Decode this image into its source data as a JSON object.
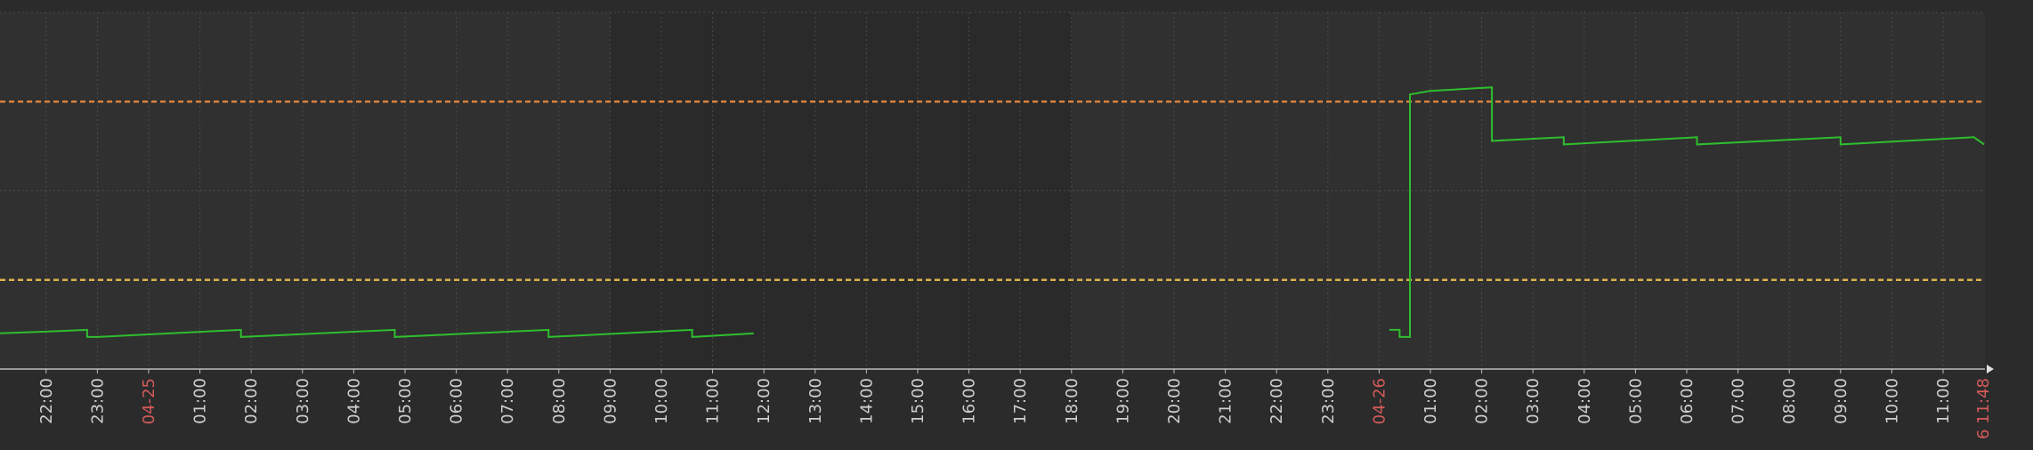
{
  "chart_data": {
    "type": "line",
    "title": "",
    "xlabel": "",
    "ylabel": "",
    "grid": true,
    "x_start": "2024-04-24 21:00",
    "x_end": "2024-04-26 11:48",
    "x_ticks": [
      {
        "label": "22:00",
        "time": "04-24 22:00",
        "red": false
      },
      {
        "label": "23:00",
        "time": "04-24 23:00",
        "red": false
      },
      {
        "label": "04-25",
        "time": "04-25 00:00",
        "red": true
      },
      {
        "label": "01:00",
        "time": "04-25 01:00",
        "red": false
      },
      {
        "label": "02:00",
        "time": "04-25 02:00",
        "red": false
      },
      {
        "label": "03:00",
        "time": "04-25 03:00",
        "red": false
      },
      {
        "label": "04:00",
        "time": "04-25 04:00",
        "red": false
      },
      {
        "label": "05:00",
        "time": "04-25 05:00",
        "red": false
      },
      {
        "label": "06:00",
        "time": "04-25 06:00",
        "red": false
      },
      {
        "label": "07:00",
        "time": "04-25 07:00",
        "red": false
      },
      {
        "label": "08:00",
        "time": "04-25 08:00",
        "red": false
      },
      {
        "label": "09:00",
        "time": "04-25 09:00",
        "red": false
      },
      {
        "label": "10:00",
        "time": "04-25 10:00",
        "red": false
      },
      {
        "label": "11:00",
        "time": "04-25 11:00",
        "red": false
      },
      {
        "label": "12:00",
        "time": "04-25 12:00",
        "red": false
      },
      {
        "label": "13:00",
        "time": "04-25 13:00",
        "red": false
      },
      {
        "label": "14:00",
        "time": "04-25 14:00",
        "red": false
      },
      {
        "label": "15:00",
        "time": "04-25 15:00",
        "red": false
      },
      {
        "label": "16:00",
        "time": "04-25 16:00",
        "red": false
      },
      {
        "label": "17:00",
        "time": "04-25 17:00",
        "red": false
      },
      {
        "label": "18:00",
        "time": "04-25 18:00",
        "red": false
      },
      {
        "label": "19:00",
        "time": "04-25 19:00",
        "red": false
      },
      {
        "label": "20:00",
        "time": "04-25 20:00",
        "red": false
      },
      {
        "label": "21:00",
        "time": "04-25 21:00",
        "red": false
      },
      {
        "label": "22:00",
        "time": "04-25 22:00",
        "red": false
      },
      {
        "label": "23:00",
        "time": "04-25 23:00",
        "red": false
      },
      {
        "label": "04-26",
        "time": "04-26 00:00",
        "red": true
      },
      {
        "label": "01:00",
        "time": "04-26 01:00",
        "red": false
      },
      {
        "label": "02:00",
        "time": "04-26 02:00",
        "red": false
      },
      {
        "label": "03:00",
        "time": "04-26 03:00",
        "red": false
      },
      {
        "label": "04:00",
        "time": "04-26 04:00",
        "red": false
      },
      {
        "label": "05:00",
        "time": "04-26 05:00",
        "red": false
      },
      {
        "label": "06:00",
        "time": "04-26 06:00",
        "red": false
      },
      {
        "label": "07:00",
        "time": "04-26 07:00",
        "red": false
      },
      {
        "label": "08:00",
        "time": "04-26 08:00",
        "red": false
      },
      {
        "label": "09:00",
        "time": "04-26 09:00",
        "red": false
      },
      {
        "label": "10:00",
        "time": "04-26 10:00",
        "red": false
      },
      {
        "label": "11:00",
        "time": "04-26 11:00",
        "red": false
      }
    ],
    "end_label": "6 11:48",
    "ylim": [
      0,
      100
    ],
    "y_gridlines": [
      25,
      50,
      75,
      100
    ],
    "thresholds": [
      {
        "value": 75,
        "color": "#d9813f"
      },
      {
        "value": 25,
        "color": "#d9b24a"
      }
    ],
    "series": [
      {
        "color": "#2fbe2f",
        "segments": [
          [
            [
              "04-24 21:00",
              10
            ],
            [
              "04-24 22:00",
              10.5
            ],
            [
              "04-24 22:48",
              11
            ],
            [
              "04-24 22:48",
              9
            ],
            [
              "04-24 23:00",
              9
            ],
            [
              "04-25 01:48",
              11
            ],
            [
              "04-25 01:48",
              9
            ],
            [
              "04-25 04:48",
              11
            ],
            [
              "04-25 04:48",
              9
            ],
            [
              "04-25 07:48",
              11
            ],
            [
              "04-25 07:48",
              9
            ],
            [
              "04-25 10:36",
              11
            ],
            [
              "04-25 10:36",
              9
            ],
            [
              "04-25 11:48",
              10
            ]
          ],
          [
            [
              "04-26 00:12",
              11
            ],
            [
              "04-26 00:24",
              11
            ],
            [
              "04-26 00:24",
              9
            ],
            [
              "04-26 00:36",
              9
            ],
            [
              "04-26 00:36",
              77
            ],
            [
              "04-26 01:00",
              78
            ],
            [
              "04-26 02:12",
              79
            ],
            [
              "04-26 02:12",
              64
            ],
            [
              "04-26 03:36",
              65
            ],
            [
              "04-26 03:36",
              63
            ],
            [
              "04-26 06:12",
              65
            ],
            [
              "04-26 06:12",
              63
            ],
            [
              "04-26 09:00",
              65
            ],
            [
              "04-26 09:00",
              63
            ],
            [
              "04-26 11:36",
              65
            ],
            [
              "04-26 11:48",
              63
            ]
          ]
        ]
      }
    ]
  }
}
